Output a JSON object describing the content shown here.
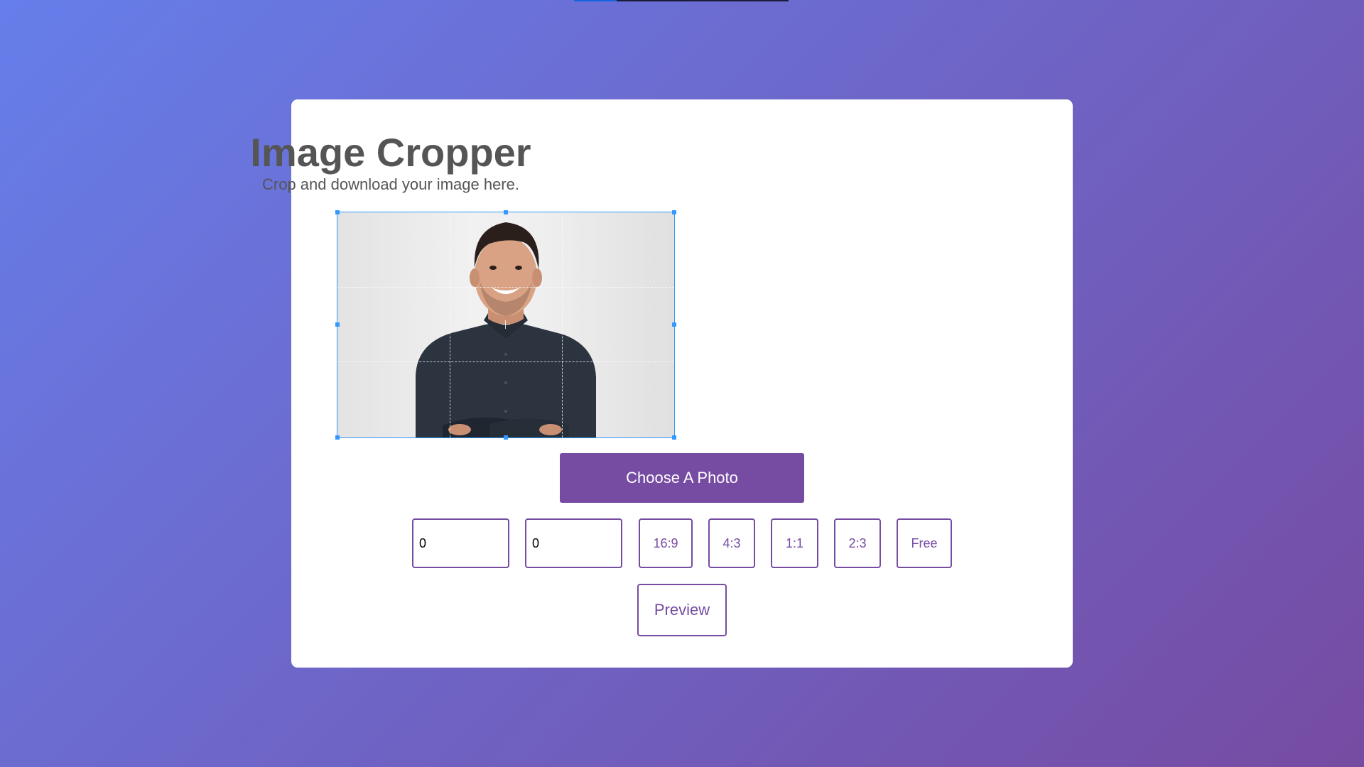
{
  "header": {
    "title": "Image Cropper",
    "subtitle": "Crop and download your image here."
  },
  "cropper": {
    "image_description": "portrait-photo"
  },
  "controls": {
    "choose_label": "Choose A Photo",
    "width_value": "0",
    "height_value": "0",
    "ratios": [
      "16:9",
      "4:3",
      "1:1",
      "2:3",
      "Free"
    ],
    "preview_label": "Preview"
  },
  "colors": {
    "accent": "#764ba2",
    "gradient_start": "#667eea",
    "gradient_end": "#764ba2",
    "crop_outline": "#3399ff"
  }
}
